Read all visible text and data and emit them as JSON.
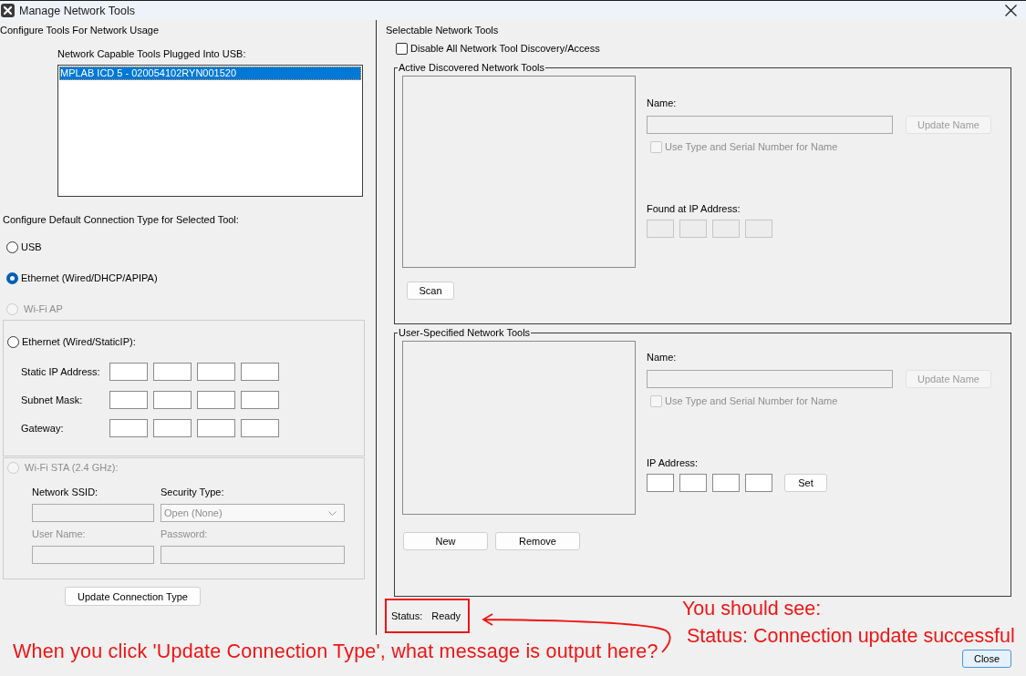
{
  "window": {
    "title": "Manage Network Tools"
  },
  "left_panel": {
    "heading": "Configure Tools For Network Usage",
    "usb_tools": {
      "label": "Network Capable Tools Plugged Into USB:",
      "items": [
        {
          "text": "MPLAB ICD 5 - 020054102RYN001520",
          "selected": true
        }
      ]
    },
    "connection_type": {
      "label": "Configure Default Connection Type for Selected Tool:",
      "options": [
        {
          "kind": "plain",
          "label": "USB",
          "selected": false,
          "disabled": false
        },
        {
          "kind": "plain",
          "label": "Ethernet (Wired/DHCP/APIPA)",
          "selected": true,
          "disabled": false
        },
        {
          "kind": "plain",
          "label": "Wi-Fi AP",
          "selected": false,
          "disabled": true
        },
        {
          "kind": "static_ip",
          "label": "Ethernet (Wired/StaticIP):",
          "selected": false,
          "disabled": false,
          "rows": [
            {
              "label": "Static IP Address:"
            },
            {
              "label": "Subnet Mask:"
            },
            {
              "label": "Gateway:"
            }
          ]
        },
        {
          "kind": "wifi_sta",
          "label": "Wi-Fi STA (2.4 GHz):",
          "selected": false,
          "disabled": true,
          "fields": [
            {
              "kind": "text",
              "label": "Network SSID:",
              "label_disabled": false,
              "disabled": true
            },
            {
              "kind": "select",
              "label": "Security Type:",
              "label_disabled": false,
              "disabled": true,
              "value": "Open (None)"
            },
            {
              "kind": "text",
              "label": "User Name:",
              "label_disabled": true,
              "disabled": true
            },
            {
              "kind": "text",
              "label": "Password:",
              "label_disabled": true,
              "disabled": true
            }
          ]
        }
      ]
    },
    "update_button": "Update Connection Type"
  },
  "right_panel": {
    "heading": "Selectable Network Tools",
    "disable_all": {
      "label": "Disable All Network Tool Discovery/Access",
      "checked": false
    },
    "groups": [
      {
        "title": "Active Discovered Network Tools",
        "name_label": "Name:",
        "name_disabled": true,
        "update_button": {
          "label": "Update Name",
          "disabled": true
        },
        "serial_checkbox": {
          "label": "Use Type and Serial Number for Name",
          "checked": false,
          "disabled": true
        },
        "ip_label": "Found at IP Address:",
        "ip_disabled": true,
        "buttons": [
          "Scan"
        ]
      },
      {
        "title": "User-Specified Network Tools",
        "name_label": "Name:",
        "name_disabled": true,
        "update_button": {
          "label": "Update Name",
          "disabled": true
        },
        "serial_checkbox": {
          "label": "Use Type and Serial Number for Name",
          "checked": false,
          "disabled": true
        },
        "ip_label": "IP Address:",
        "ip_disabled": false,
        "set_button": "Set",
        "buttons": [
          "New",
          "Remove"
        ]
      }
    ]
  },
  "status": {
    "label": "Status:",
    "value": "Ready"
  },
  "close_button": {
    "label": "Close",
    "default": true
  },
  "annotations": {
    "question": "When you click 'Update Connection Type', what message is output here?",
    "answer_intro": "You should see:",
    "answer": "Status: Connection update successful"
  }
}
